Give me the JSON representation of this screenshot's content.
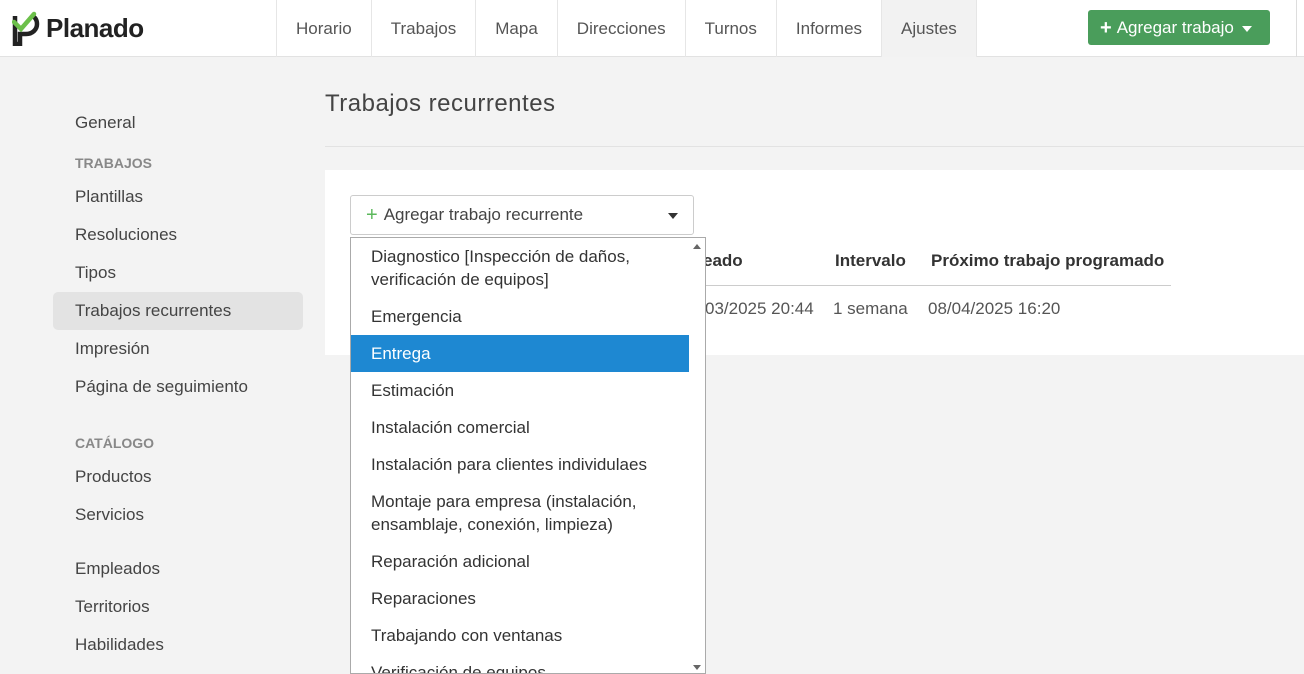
{
  "app": {
    "logo_text": "Planado"
  },
  "nav": {
    "items": [
      "Horario",
      "Trabajos",
      "Mapa",
      "Direcciones",
      "Turnos",
      "Informes",
      "Ajustes"
    ],
    "active": "Ajustes"
  },
  "header": {
    "add_job_label": "Agregar trabajo"
  },
  "sidebar": {
    "general": "General",
    "trabajos_header": "TRABAJOS",
    "plantillas": "Plantillas",
    "resoluciones": "Resoluciones",
    "tipos": "Tipos",
    "trabajos_recurrentes": "Trabajos recurrentes",
    "impresion": "Impresión",
    "pagina_seguimiento": "Página de seguimiento",
    "catalogo_header": "CATÁLOGO",
    "productos": "Productos",
    "servicios": "Servicios",
    "empleados": "Empleados",
    "territorios": "Territorios",
    "habilidades": "Habilidades"
  },
  "main": {
    "title": "Trabajos recurrentes",
    "add_recurring_label": "Agregar trabajo recurrente",
    "columns": {
      "created_partial": "eado",
      "interval": "Intervalo",
      "next": "Próximo trabajo programado"
    },
    "row": {
      "created_partial": "03/2025 20:44",
      "interval": "1 semana",
      "next": "08/04/2025 16:20"
    }
  },
  "menu": {
    "items": [
      "Diagnostico [Inspección de daños, verificación de equipos]",
      "Emergencia",
      "Entrega",
      "Estimación",
      "Instalación comercial",
      "Instalación para clientes individulaes",
      "Montaje para empresa (instalación, ensamblaje, conexión, limpieza)",
      "Reparación adicional",
      "Reparaciones",
      "Trabajando con ventanas",
      "Verificación de equipos"
    ],
    "selected": "Entrega"
  },
  "colors": {
    "brand_green": "#4a9d5b",
    "selection_blue": "#1e88d2",
    "logo_check": "#6cc04a"
  }
}
